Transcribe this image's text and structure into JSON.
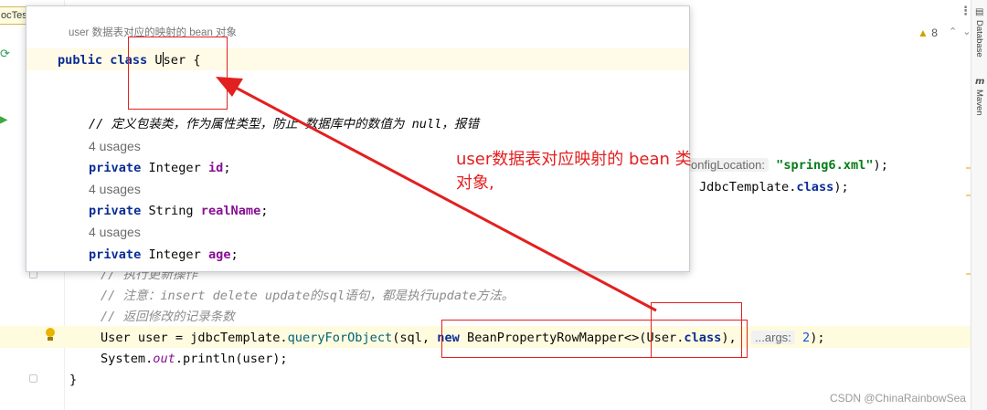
{
  "editor": {
    "tab_stub": "ocTes",
    "visible_fragment_1": "onfigLocation:",
    "visible_fragment_1_value": "\"spring6.xml\"",
    "visible_fragment_1_end": ");",
    "visible_fragment_2": "JdbcTemplate.",
    "visible_fragment_2_kw": "class",
    "visible_fragment_2_end": ");",
    "comment_exec": "// 执行更新操作",
    "comment_note": "// 注意：insert delete update的sql语句，都是执行update方法。",
    "comment_return": "// 返回修改的记录条数",
    "query_line": {
      "part1": "User user = jdbcTemplate.",
      "method": "queryForObject",
      "part2": "(sql, ",
      "kw_new": "new",
      "part3": " BeanPropertyRowMapper<>(User.",
      "kw_class": "class",
      "part4": "),",
      "hint": "...args:",
      "arg_value": "2",
      "end": ");"
    },
    "print_line": {
      "part1": "System.",
      "static_field": "out",
      "part2": ".println(user);"
    },
    "closing_brace": "}"
  },
  "popup": {
    "header": "user 数据表对应的映射的 bean 对象",
    "class_decl": {
      "kw_public": "public",
      "kw_class": "class",
      "name_first": "U",
      "name_rest": "ser",
      "brace": "{"
    },
    "comment": "// 定义包装类，作为属性类型，防止 数据库中的数值为 null，报错",
    "usage_label": "4 usages",
    "fields": [
      {
        "kw": "private",
        "type": "Integer",
        "name": "id",
        "end": ";"
      },
      {
        "kw": "private",
        "type": "String",
        "name": "realName",
        "end": ";"
      },
      {
        "kw": "private",
        "type": "Integer",
        "name": "age",
        "end": ";"
      }
    ]
  },
  "annotation": {
    "text": "user数据表对应映射的 bean 类对象,",
    "color": "#e22020"
  },
  "right_panel": {
    "warning_count": "8",
    "database_tab": "Database",
    "maven_tab": "Maven"
  },
  "watermark": "CSDN @ChinaRainbowSea",
  "colors": {
    "keyword": "#0a2d96",
    "field": "#871094",
    "string": "#067d17",
    "comment": "#8c8c8c",
    "method": "#00627a",
    "caret_line": "#fffbdf"
  }
}
